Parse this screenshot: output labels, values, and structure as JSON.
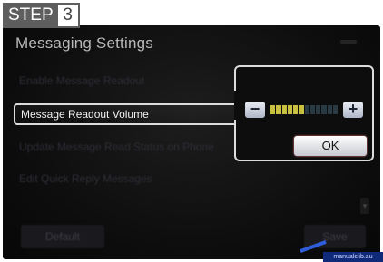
{
  "step": {
    "label": "STEP",
    "number": "3"
  },
  "screen": {
    "title": "Messaging Settings",
    "menu_items": [
      {
        "label": "Enable Message Readout",
        "state": "dim"
      },
      {
        "label": "Message Readout Volume",
        "state": "selected"
      },
      {
        "label": "Update Message Read Status on Phone",
        "state": "dim"
      },
      {
        "label": "Edit Quick Reply Messages",
        "state": "dim"
      }
    ],
    "volume_popup": {
      "minus": "−",
      "plus": "+",
      "level": 6,
      "max_level": 12,
      "ok": "OK"
    },
    "footer": {
      "default": "Default",
      "save": "Save"
    },
    "watermark": "manualslib.au"
  },
  "colors": {
    "selected_border": "#dcdcdc",
    "level_on": "#c8c040",
    "background": "#0c0c0c"
  }
}
